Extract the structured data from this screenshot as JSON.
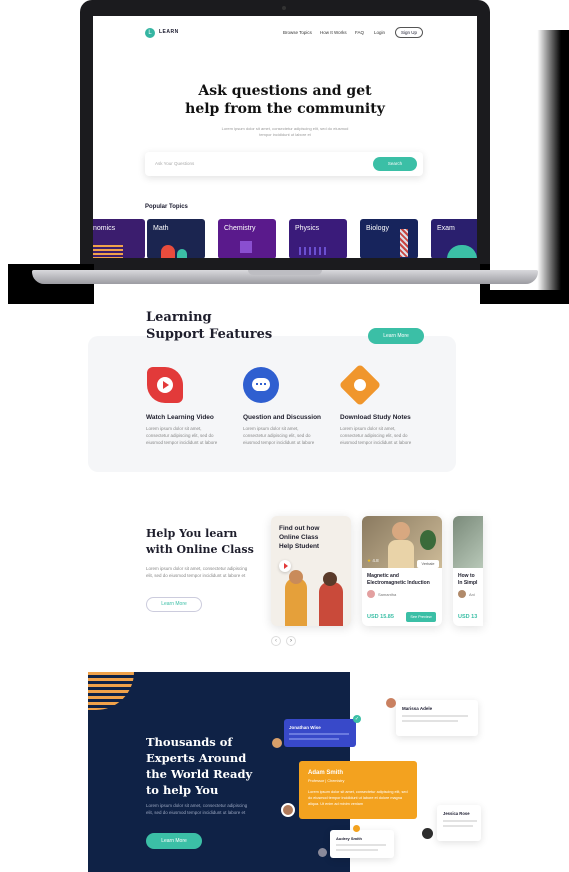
{
  "nav": {
    "brand": "LEARN",
    "logo_letter": "L",
    "links": [
      "Browse Topics",
      "How It Works",
      "FAQ",
      "Login"
    ],
    "signup": "Sign Up"
  },
  "hero": {
    "title_line1": "Ask questions and get",
    "title_line2": "help from the community",
    "subtitle": "Lorem ipsum dolor sit amet, consectetur adipiscing elit, sed do eiusmod tempor incididunt ut labore et",
    "search_placeholder": "Ask Your Questions",
    "search_button": "Search"
  },
  "topics": {
    "heading": "Popular Topics",
    "items": [
      {
        "label": "nomics",
        "color": "#3b1d6e"
      },
      {
        "label": "Math",
        "color": "#1b2550"
      },
      {
        "label": "Chemistry",
        "color": "#5a1a8c"
      },
      {
        "label": "Physics",
        "color": "#3a1b7a"
      },
      {
        "label": "Biology",
        "color": "#17245c"
      },
      {
        "label": "Exam",
        "color": "#2a1f6e"
      }
    ]
  },
  "features": {
    "title_line1": "Learning",
    "title_line2": "Support Features",
    "button": "Learn More",
    "items": [
      {
        "title": "Watch Learning Video",
        "icon": "play-icon",
        "color": "#e23a3a",
        "text": "Lorem ipsum dolor sit amet, consectetur adipiscing elit, sed do eiusmod tempor incididunt ut labore"
      },
      {
        "title": "Question and Discussion",
        "icon": "chat-icon",
        "color": "#2f5fd0",
        "text": "Lorem ipsum dolor sit amet, consectetur adipiscing elit, sed do eiusmod tempor incididunt ut labore"
      },
      {
        "title": "Download Study Notes",
        "icon": "download-icon",
        "color": "#f0962c",
        "text": "Lorem ipsum dolor sit amet, consectetur adipiscing elit, sed do eiusmod tempor incididunt ut labore"
      }
    ]
  },
  "online": {
    "title_line1": "Help You learn",
    "title_line2": "with Online Class",
    "text": "Lorem ipsum dolor sit amet, consectetur adipiscing elit, sed do eiusmod tempor incididunt ut labore et",
    "button": "Learn More",
    "promo_line1": "Find out how",
    "promo_line2": "Online Class",
    "promo_line3": "Help Student",
    "course1": {
      "rating": "4.8",
      "badge": "Verbale",
      "title_line1": "Magnetic and",
      "title_line2": "Electromagnetic Induction",
      "author": "Samantha",
      "price": "USD 15.85",
      "button": "See Preview"
    },
    "course2": {
      "title_line1": "How to",
      "title_line2": "In Simpl",
      "author": "Ani",
      "price": "USD 13"
    }
  },
  "experts": {
    "title_line1": "Thousands of",
    "title_line2": "Experts Around",
    "title_line3": "the World Ready",
    "title_line4": "to help You",
    "text": "Lorem ipsum dolor sit amet, consectetur adipiscing elit, sed do eiusmod tempor incididunt ut labore et",
    "button": "Learn More",
    "cards": {
      "jonathan": "Jonathan Wise",
      "marisa": "Marissa Adele",
      "adam": "Adam Smith",
      "adam_sub": "Professor  |  Chemistry",
      "adam_text": "Lorem ipsum dolor sit amet, consectetur adipiscing elit, sed do eiusmod tempor incididunt ut labore et dolore magna aliqua. Ut enim ad minim veniam",
      "jessica": "Jessica Rose",
      "audrey": "Audrey Smith"
    }
  }
}
